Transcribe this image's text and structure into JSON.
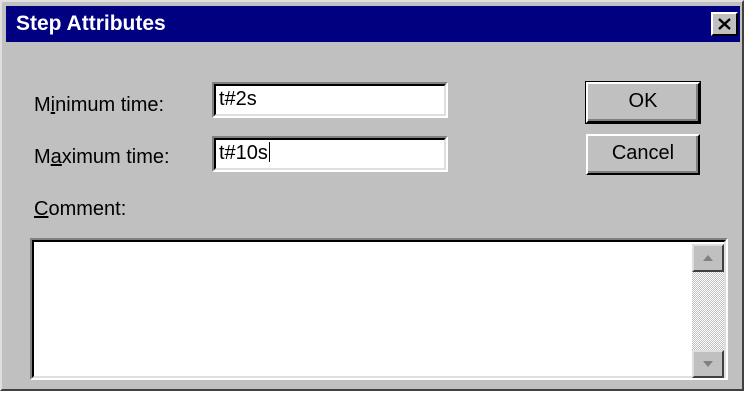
{
  "dialog": {
    "title": "Step Attributes",
    "close_icon": "close-x-icon"
  },
  "form": {
    "min_time": {
      "label_accesskey": "i",
      "label_before": "M",
      "label_after": "nimum time:",
      "value": "t#2s"
    },
    "max_time": {
      "label_before": "M",
      "label_accesskey": "a",
      "label_after": "ximum time:",
      "value": "t#10s"
    },
    "comment": {
      "label_accesskey": "C",
      "label_after": "omment:",
      "value": ""
    }
  },
  "buttons": {
    "ok_label": "OK",
    "cancel_label": "Cancel"
  },
  "scrollbar": {
    "up_icon": "scroll-up-arrow-icon",
    "down_icon": "scroll-down-arrow-icon"
  }
}
